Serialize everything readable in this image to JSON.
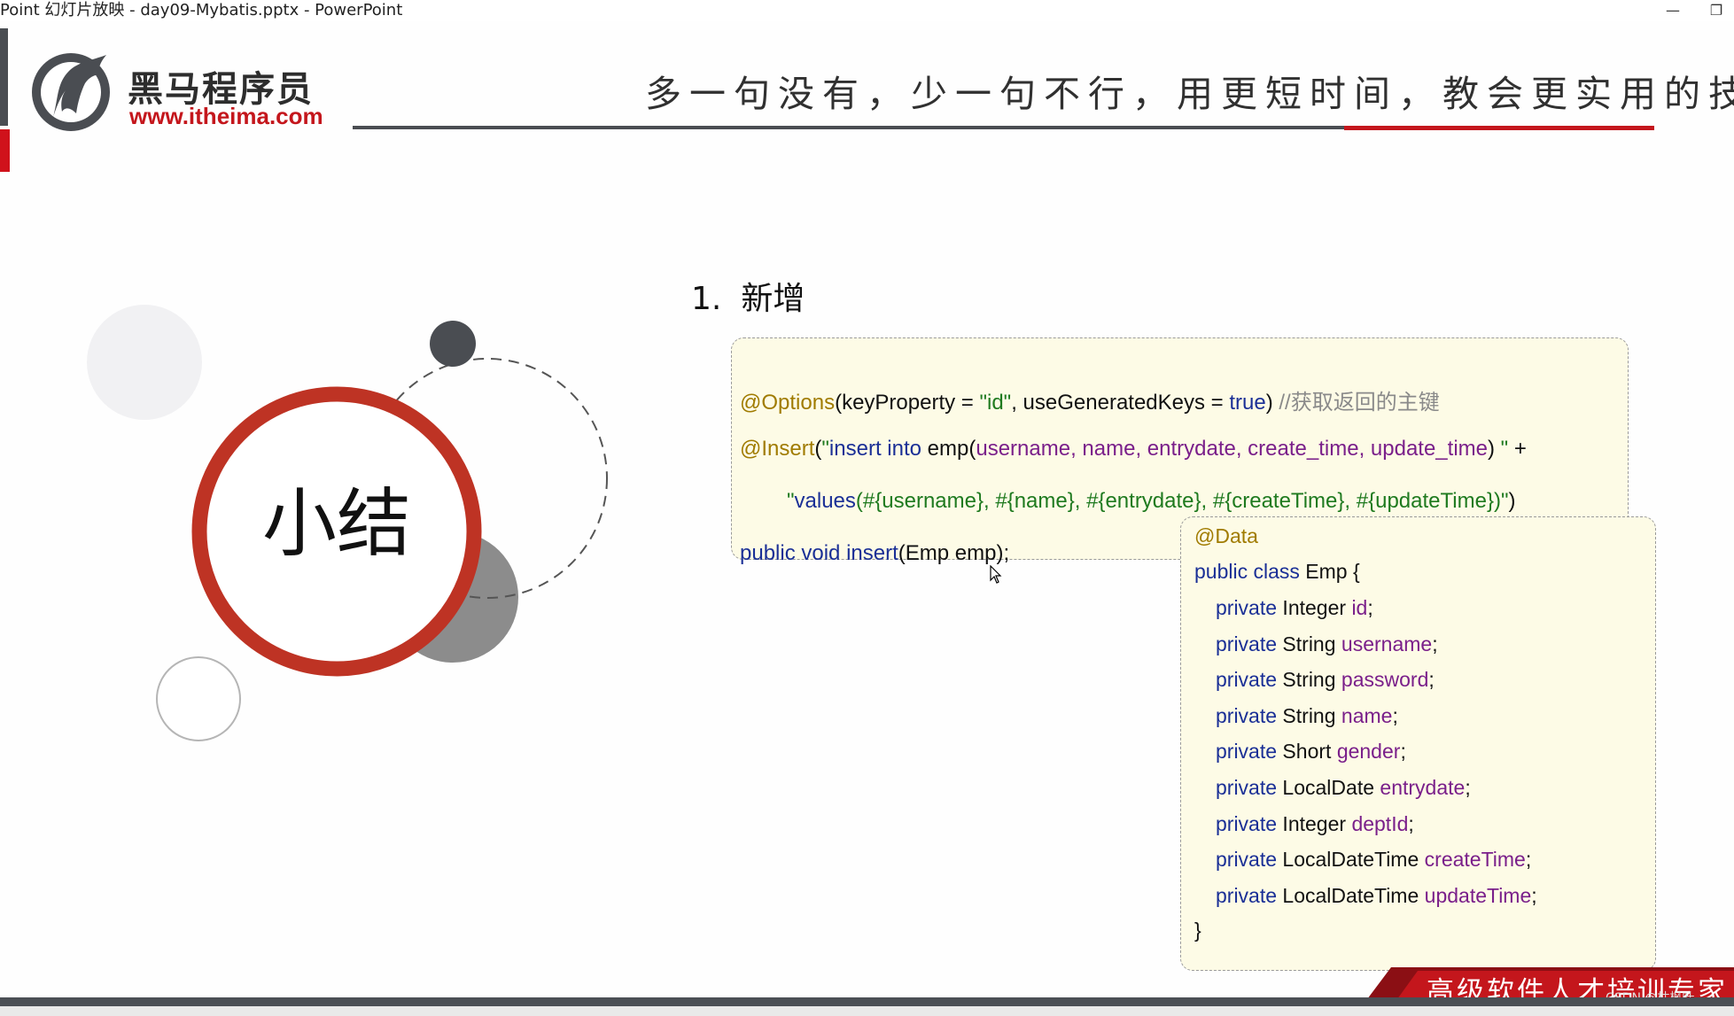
{
  "window": {
    "title": "Point 幻灯片放映  -  day09-Mybatis.pptx - PowerPoint",
    "minimize_glyph": "—",
    "restore_glyph": "❐"
  },
  "header": {
    "logo_cn": "黑马程序员",
    "logo_url": "www.itheima.com",
    "slogan": "多一句没有，少一句不行，用更短时间，教会更实用的技术!"
  },
  "colors": {
    "accent_red": "#c4161c",
    "dark_grey": "#4a4d52",
    "code_bg": "#fdfbe6"
  },
  "summary": {
    "label": "小结"
  },
  "section": {
    "number": "1.",
    "title": "新增"
  },
  "code_insert": {
    "line1": {
      "annotation": "@Options",
      "p1": "(keyProperty = ",
      "s1": "\"id\"",
      "p2": ", useGeneratedKeys = ",
      "kw": "true",
      "p3": ") ",
      "comment": "//获取返回的主键"
    },
    "line2": {
      "annotation": "@Insert",
      "p1": "(",
      "s1": "\"",
      "kw": "insert into",
      "p2": " emp(",
      "fields": "username, name, entrydate, create_time, update_time",
      "p3": ") ",
      "s2": "\"",
      "p4": " +"
    },
    "line3": {
      "s1": "\"",
      "kw": "values",
      "s2": "(#{username}, #{name}, #{entrydate}, #{createTime}, #{updateTime})",
      "s3": "\"",
      "p1": ")"
    },
    "line4": {
      "kw": "public void insert",
      "p1": "(Emp emp);"
    }
  },
  "code_entity": {
    "annotation": "@Data",
    "class_kw": "public class",
    "class_rest": " Emp {",
    "fields": [
      {
        "mod": "private",
        "type": " Integer ",
        "name": "id"
      },
      {
        "mod": "private",
        "type": " String ",
        "name": "username"
      },
      {
        "mod": "private",
        "type": " String ",
        "name": "password"
      },
      {
        "mod": "private",
        "type": " String ",
        "name": "name"
      },
      {
        "mod": "private",
        "type": " Short ",
        "name": "gender"
      },
      {
        "mod": "private",
        "type": " LocalDate ",
        "name": "entrydate"
      },
      {
        "mod": "private",
        "type": " Integer ",
        "name": "deptId"
      },
      {
        "mod": "private",
        "type": " LocalDateTime ",
        "name": "createTime"
      },
      {
        "mod": "private",
        "type": " LocalDateTime ",
        "name": "updateTime"
      }
    ],
    "semicolon": ";",
    "close": "}"
  },
  "footer": {
    "text": "高级软件人才培训专家",
    "watermark": "CSDN @枯枫叶"
  }
}
